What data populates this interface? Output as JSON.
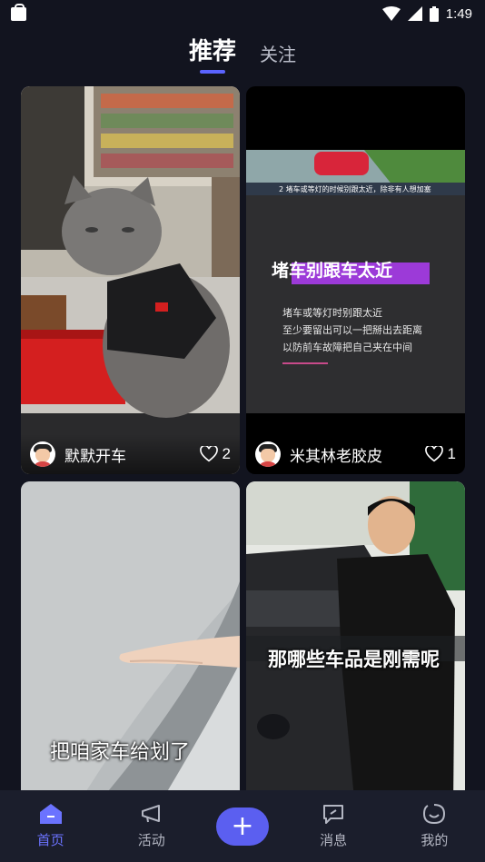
{
  "status_bar": {
    "time": "1:49"
  },
  "top_tabs": {
    "recommend": "推荐",
    "follow": "关注"
  },
  "feed": {
    "cards": [
      {
        "author": "默默开车",
        "likes": "2",
        "caption": ""
      },
      {
        "author": "米其林老胶皮",
        "likes": "1",
        "caption": "",
        "video": {
          "banner_caption": "2 堵车或等灯的时候别跟太近，除非有人想加塞",
          "title": "堵车别跟车太近",
          "lines": [
            "堵车或等灯时别跟太近",
            "至少要留出可以一把掰出去距离",
            "以防前车故障把自己夹在中间"
          ]
        }
      },
      {
        "author": "",
        "likes": "",
        "caption": "把咱家车给划了"
      },
      {
        "author": "",
        "likes": "",
        "caption": "那哪些车品是刚需呢"
      }
    ]
  },
  "bottom_nav": {
    "home": "首页",
    "activity": "活动",
    "messages": "消息",
    "mine": "我的",
    "plus": "+"
  },
  "colors": {
    "accent": "#5b64ff",
    "background": "#12141f",
    "nav_bg": "#1b1e2c"
  }
}
